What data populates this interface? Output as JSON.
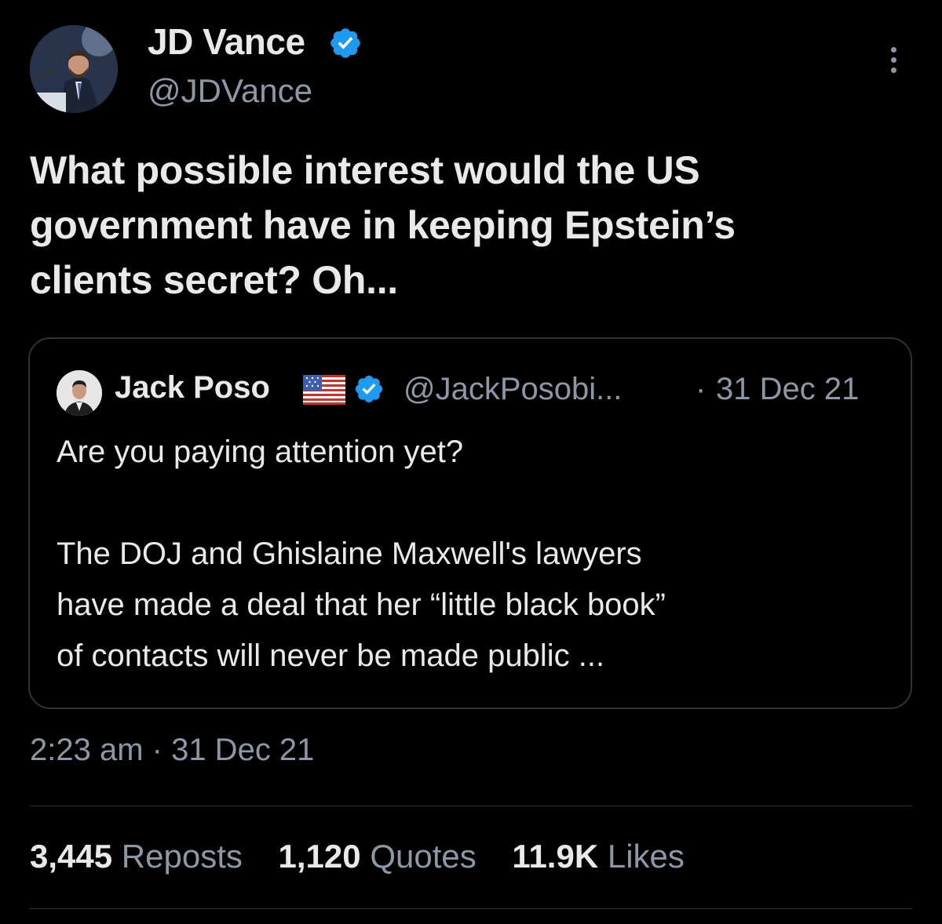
{
  "author": {
    "name": "JD Vance",
    "handle": "@JDVance",
    "verified_color": "#1d9bf0"
  },
  "tweet": {
    "text": "What possible interest would the US\ngovernment have in keeping Epstein’s\nclients secret? Oh...",
    "timestamp": "2:23 am · 31 Dec 21"
  },
  "quoted": {
    "name": "Jack Poso",
    "flag_icon": "us-flag-icon",
    "handle": "@JackPosobi...",
    "separator": "·",
    "date": "31 Dec 21",
    "text": "Are you paying attention yet?\n\nThe DOJ and Ghislaine Maxwell's lawyers\nhave made a deal that her “little black book”\nof contacts will never be made public ..."
  },
  "stats": [
    {
      "value": "3,445",
      "label": "Reposts"
    },
    {
      "value": "1,120",
      "label": "Quotes"
    },
    {
      "value": "11.9K",
      "label": "Likes"
    }
  ],
  "colors": {
    "background": "#000000",
    "text": "#e7e9ea",
    "secondary": "#8b98a5",
    "border": "#2f3336"
  }
}
